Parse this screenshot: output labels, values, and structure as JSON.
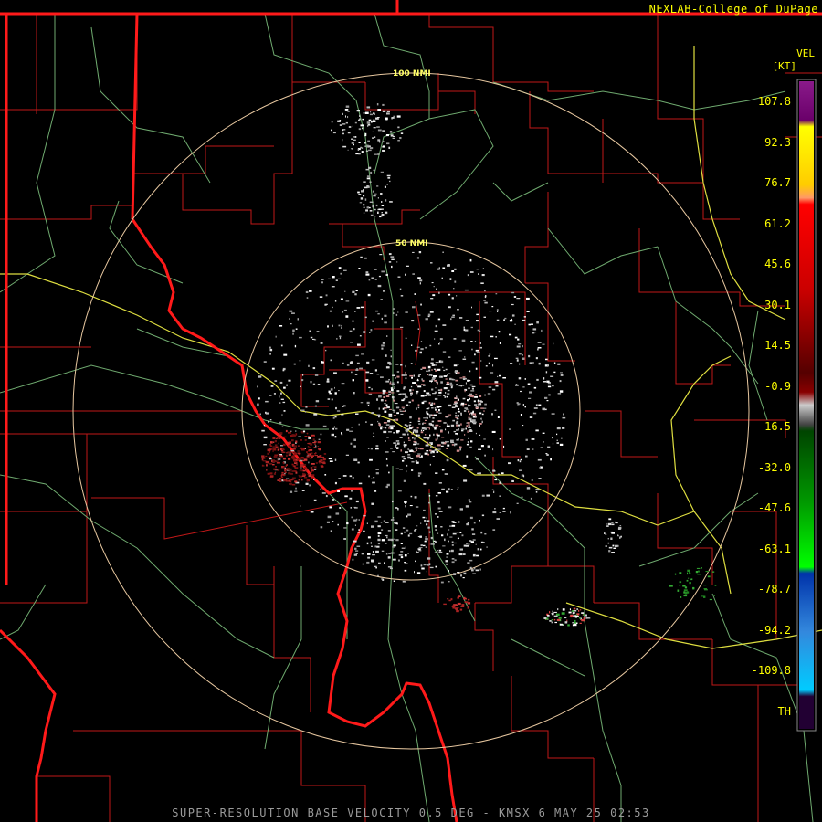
{
  "header": {
    "credit": "NEXLAB-College of DuPage"
  },
  "footer": {
    "caption": "SUPER-RESOLUTION BASE VELOCITY 0.5 DEG - KMSX 6 MAY 25 02:53"
  },
  "rings": {
    "inner_label": "50 NMI",
    "outer_label": "100 NMI"
  },
  "legend": {
    "product": "VEL",
    "unit": "[KT]",
    "ticks": [
      "107.8",
      "92.3",
      "76.7",
      "61.2",
      "45.6",
      "30.1",
      "14.5",
      "-0.9",
      "-16.5",
      "-32.0",
      "-47.6",
      "-63.1",
      "-78.7",
      "-94.2",
      "-109.8"
    ],
    "threshold_label": "TH",
    "colors": {
      "state_line": "#ff1a1a",
      "county_line": "#cc2020",
      "highway": "#dddd44",
      "road": "#7fbf7f",
      "range_ring": "#e8c8a0"
    }
  }
}
